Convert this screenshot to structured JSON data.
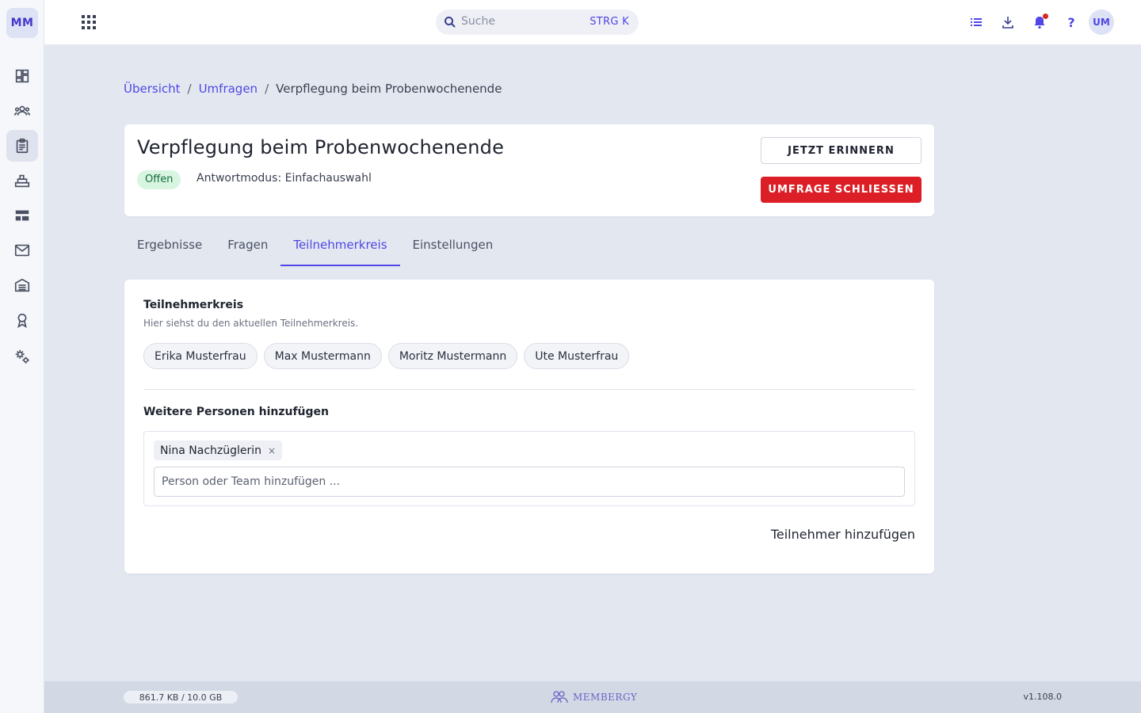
{
  "app": {
    "logo_text": "MM",
    "user_initials": "UM",
    "accent_color": "#4f46e5",
    "danger_color": "#dc1f26"
  },
  "search": {
    "placeholder": "Suche",
    "shortcut": "STRG K"
  },
  "sidebar": {
    "items": [
      {
        "icon": "dashboard-icon",
        "active": false
      },
      {
        "icon": "members-icon",
        "active": false
      },
      {
        "icon": "clipboard-icon",
        "active": true
      },
      {
        "icon": "inventory-icon",
        "active": false
      },
      {
        "icon": "layout-icon",
        "active": false
      },
      {
        "icon": "mail-icon",
        "active": false
      },
      {
        "icon": "warehouse-icon",
        "active": false
      },
      {
        "icon": "award-icon",
        "active": false
      },
      {
        "icon": "settings-icon",
        "active": false
      }
    ]
  },
  "topbar": {
    "icons": [
      "list-icon",
      "download-icon",
      "bell-icon",
      "help-icon"
    ],
    "help_label": "?"
  },
  "breadcrumb": {
    "items": [
      "Übersicht",
      "Umfragen",
      "Verpflegung beim Probenwochenende"
    ],
    "separator": "/"
  },
  "survey": {
    "title": "Verpflegung beim Probenwochenende",
    "status": "Offen",
    "answer_mode": "Antwortmodus: Einfachauswahl",
    "remind_label": "JETZT ERINNERN",
    "close_label": "UMFRAGE SCHLIESSEN"
  },
  "tabs": [
    {
      "label": "Ergebnisse",
      "active": false
    },
    {
      "label": "Fragen",
      "active": false
    },
    {
      "label": "Teilnehmerkreis",
      "active": true
    },
    {
      "label": "Einstellungen",
      "active": false
    }
  ],
  "participants": {
    "title": "Teilnehmerkreis",
    "subtitle": "Hier siehst du den aktuellen Teilnehmerkreis.",
    "members": [
      "Erika Musterfrau",
      "Max Mustermann",
      "Moritz Mustermann",
      "Ute Musterfrau"
    ]
  },
  "add_people": {
    "title": "Weitere Personen hinzufügen",
    "selected": [
      "Nina Nachzüglerin"
    ],
    "remove_symbol": "×",
    "input_value": "",
    "input_placeholder": "Person oder Team hinzufügen ...",
    "submit_label": "Teilnehmer hinzufügen"
  },
  "footer": {
    "storage": "861.7 KB / 10.0 GB",
    "brand": "MEMBERGY",
    "version": "v1.108.0"
  }
}
